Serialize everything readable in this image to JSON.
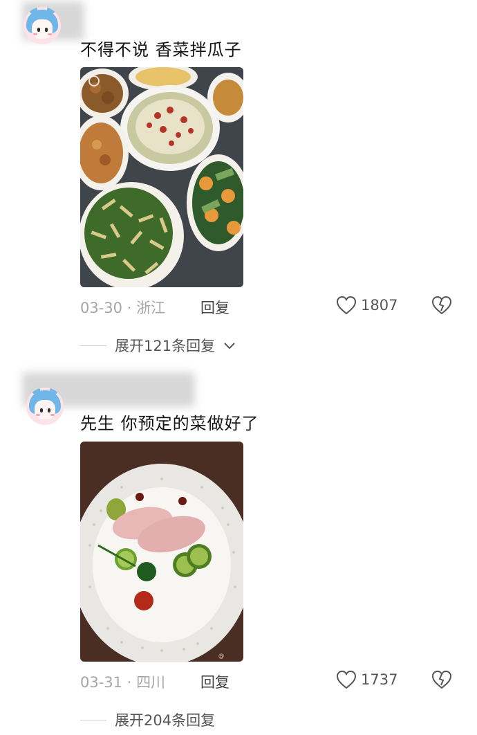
{
  "comments": [
    {
      "text": "不得不说  香菜拌瓜子",
      "date": "03-30",
      "location": "浙江",
      "reply_label": "回复",
      "likes": "1807",
      "expand_label": "展开121条回复"
    },
    {
      "text": "先生 你预定的菜做好了",
      "date": "03-31",
      "location": "四川",
      "reply_label": "回复",
      "likes": "1737",
      "expand_label": "展开204条回复"
    }
  ],
  "separator": " · ",
  "colors": {
    "meta": "#a6a6a6",
    "text": "#151515",
    "avatar_hair": "#6fb7e8"
  }
}
